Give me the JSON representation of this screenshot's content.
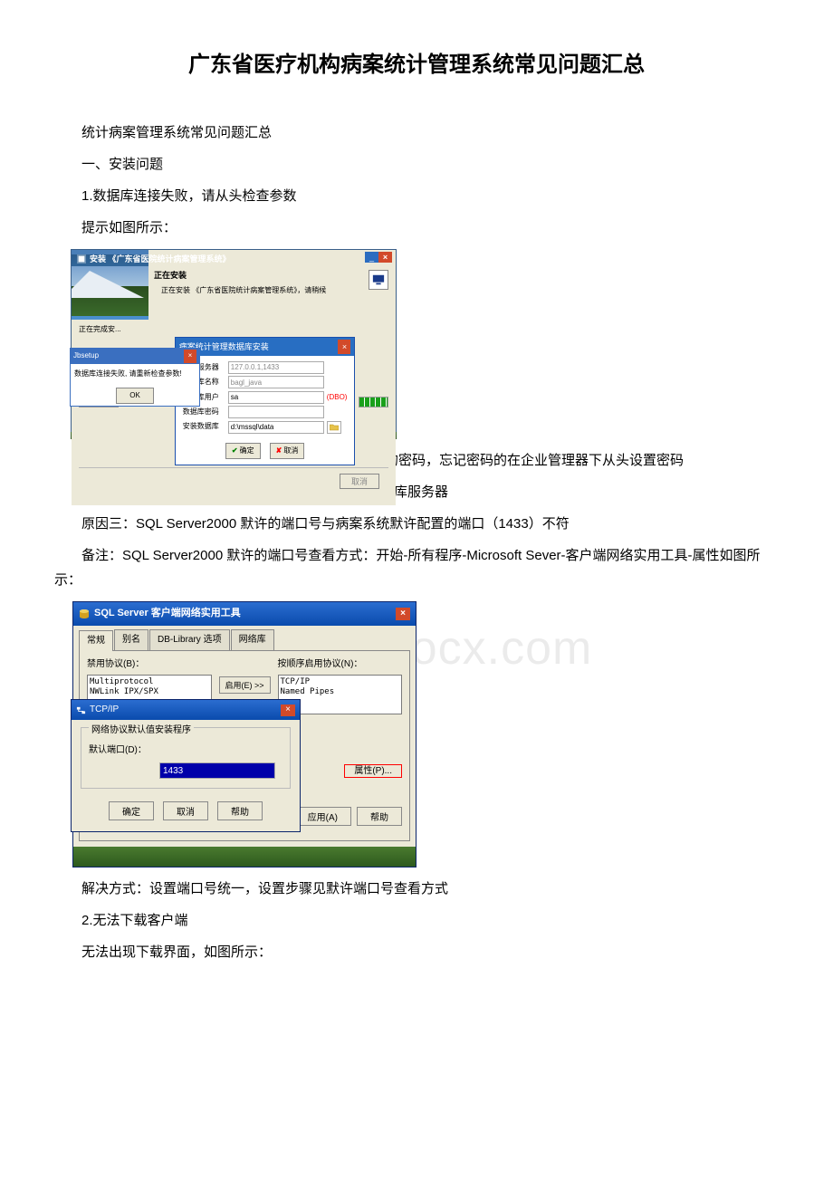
{
  "title": "广东省医疗机构病案统计管理系统常见问题汇总",
  "watermark": "www.bdocx.com",
  "intro": {
    "line1": "统计病案管理系统常见问题汇总",
    "section1": "一、安装问题",
    "q1": "1.数据库连接失败，请从头检查参数",
    "q1_tip": "提示如图所示："
  },
  "installer": {
    "window_title": "安装 《广东省医院统计病案管理系统》",
    "heading": "正在安装",
    "sub": "正在安装 《广东省医院统计病案管理系统》，请稍候",
    "progress_label": "正在完成安...",
    "inner_title": "病案统计管理数据库安装",
    "fields": {
      "server_label": "数据服务器",
      "server_value": "127.0.0.1,1433",
      "dbname_label": "数据库名称",
      "dbname_value": "bagl_java",
      "user_label": "数据库用户",
      "user_value": "sa",
      "dbo": "(DBO)",
      "pwd_label": "数据库密码",
      "pwd_value": "",
      "path_label": "安装数据库",
      "path_value": "d:\\mssql\\data"
    },
    "ok_btn": "确定",
    "cancel_btn": "取消",
    "err_title": "Jbsetup",
    "err_msg": "数据库连接失败, 请重新检查参数!",
    "err_ok": "OK",
    "footer_btn": "取消"
  },
  "explain": {
    "reason1": "原因一：sa 密码输入不对　。解决方式：输入正确的密码，忘记密码的在企业管理器下从头设置密码",
    "reason2": "原因二：数据库服务器未启动。解决方式：启动数据库服务器",
    "reason3": "原因三：SQL Server2000 默许的端口号与病案系统默许配置的端口（1433）不符",
    "note": "备注：SQL Server2000 默许的端口号查看方式：开始-所有程序-Microsoft Sever-客户端网络实用工具-属性如图所示："
  },
  "sql_util": {
    "title": "SQL Server 客户端网络实用工具",
    "tabs": {
      "general": "常规",
      "alias": "别名",
      "dblib": "DB-Library 选项",
      "netlib": "网络库"
    },
    "disabled_label": "禁用协议(B)：",
    "disabled_list": "Multiprotocol\nNWLink IPX/SPX",
    "enable_btn": "启用(E) >>",
    "enabled_label": "按顺序启用协议(N)：",
    "enabled_list": "TCP/IP\nNamed Pipes",
    "properties_btn": "属性(P)...",
    "apply_btn": "应用(A)",
    "help_btn": "帮助",
    "tcp": {
      "title": "TCP/IP",
      "group": "网络协议默认值安装程序",
      "port_label": "默认端口(D)：",
      "port_value": "1433",
      "ok": "确定",
      "cancel": "取消",
      "help": "帮助"
    }
  },
  "after": {
    "solution": "解决方式：设置端口号统一，设置步骤见默许端口号查看方式",
    "q2": "2.无法下载客户端",
    "q2_tip": "无法出现下载界面，如图所示："
  }
}
